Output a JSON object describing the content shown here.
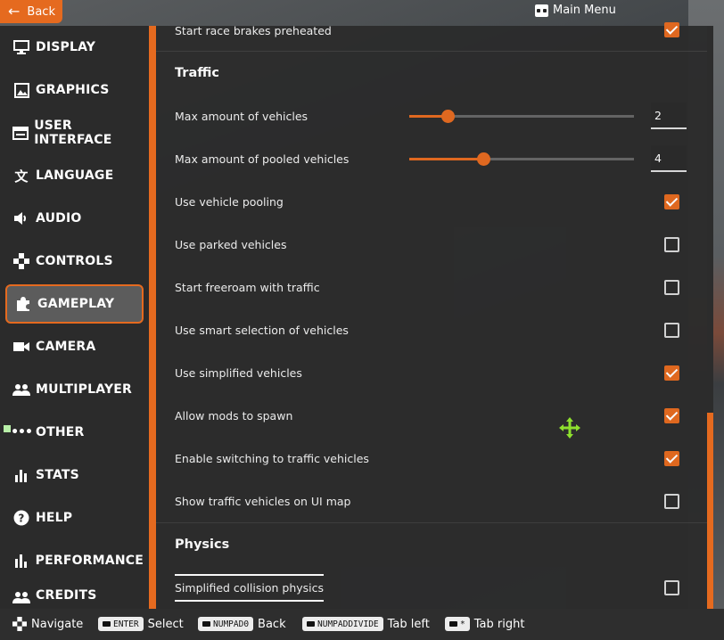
{
  "topbar": {
    "back_label": "Back",
    "main_menu_label": "Main Menu"
  },
  "sidebar": {
    "items": [
      {
        "label": "DISPLAY",
        "icon": "monitor-icon"
      },
      {
        "label": "GRAPHICS",
        "icon": "image-icon"
      },
      {
        "label": "USER INTERFACE",
        "icon": "ui-icon"
      },
      {
        "label": "LANGUAGE",
        "icon": "translate-icon"
      },
      {
        "label": "AUDIO",
        "icon": "speaker-icon"
      },
      {
        "label": "CONTROLS",
        "icon": "gamepad-icon"
      },
      {
        "label": "GAMEPLAY",
        "icon": "puzzle-icon",
        "active": true
      },
      {
        "label": "CAMERA",
        "icon": "camera-icon"
      },
      {
        "label": "MULTIPLAYER",
        "icon": "people-icon"
      },
      {
        "label": "OTHER",
        "icon": "more-icon"
      },
      {
        "label": "STATS",
        "icon": "bar-chart-icon"
      },
      {
        "label": "HELP",
        "icon": "help-icon"
      },
      {
        "label": "PERFORMANCE",
        "icon": "performance-icon"
      },
      {
        "label": "CREDITS",
        "icon": "credits-icon"
      }
    ]
  },
  "content": {
    "top_row": {
      "label": "Start race brakes preheated",
      "checked": true
    },
    "traffic": {
      "title": "Traffic",
      "max_vehicles": {
        "label": "Max amount of vehicles",
        "value": "2",
        "fraction": 0.17
      },
      "max_pooled": {
        "label": "Max amount of pooled vehicles",
        "value": "4",
        "fraction": 0.33
      },
      "options": [
        {
          "label": "Use vehicle pooling",
          "checked": true
        },
        {
          "label": "Use parked vehicles",
          "checked": false
        },
        {
          "label": "Start freeroam with traffic",
          "checked": false
        },
        {
          "label": "Use smart selection of vehicles",
          "checked": false
        },
        {
          "label": "Use simplified vehicles",
          "checked": true
        },
        {
          "label": "Allow mods to spawn",
          "checked": true
        },
        {
          "label": "Enable switching to traffic vehicles",
          "checked": true
        },
        {
          "label": "Show traffic vehicles on UI map",
          "checked": false
        }
      ]
    },
    "physics": {
      "title": "Physics",
      "options": [
        {
          "label": "Simplified collision physics",
          "checked": false
        }
      ]
    }
  },
  "bottombar": {
    "navigate": "Navigate",
    "select_key": "ENTER",
    "select": "Select",
    "back_key": "NUMPAD0",
    "back": "Back",
    "tab_left_key": "NUMPADDIVIDE",
    "tab_left": "Tab left",
    "tab_right_key": "*",
    "tab_right": "Tab right"
  },
  "colors": {
    "accent": "#e56a1f",
    "panel": "#2c2c2c"
  }
}
